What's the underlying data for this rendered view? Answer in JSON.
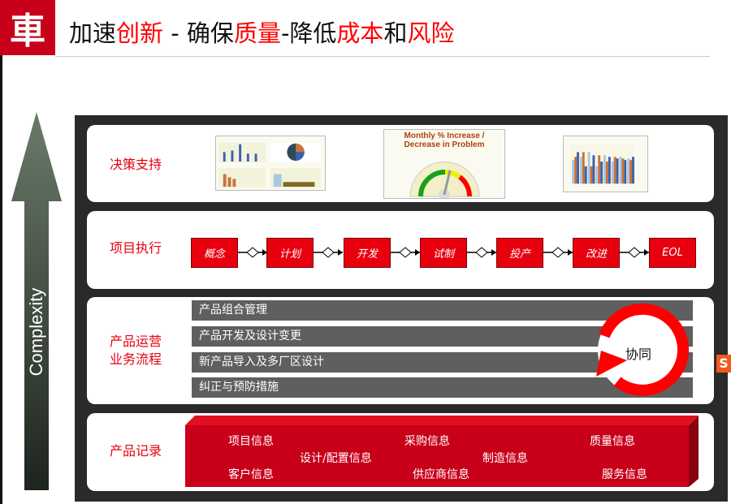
{
  "header": {
    "logo_glyph": "車",
    "title_parts": [
      {
        "text": "加速",
        "red": false
      },
      {
        "text": "创新",
        "red": true
      },
      {
        "text": " - 确保",
        "red": false
      },
      {
        "text": "质量",
        "red": true
      },
      {
        "text": "-降低",
        "red": false
      },
      {
        "text": "成本",
        "red": true
      },
      {
        "text": "和",
        "red": false
      },
      {
        "text": "风险",
        "red": true
      }
    ]
  },
  "axis": {
    "label": "Complexity"
  },
  "rows": {
    "decision": {
      "label": "决策支持",
      "gauge_title": "Monthly % Increase / Decrease in Problem"
    },
    "execution": {
      "label": "项目执行",
      "steps": [
        "概念",
        "计划",
        "开发",
        "试制",
        "投产",
        "改进",
        "EOL"
      ]
    },
    "operations": {
      "label_line1": "产品运营",
      "label_line2": "业务流程",
      "bars": [
        "产品组合管理",
        "产品开发及设计变更",
        "新产品导入及多厂区设计",
        "纠正与预防措施"
      ],
      "cycle_label": "协同"
    },
    "records": {
      "label": "产品记录",
      "items": [
        "项目信息",
        "客户信息",
        "设计/配置信息",
        "采购信息",
        "供应商信息",
        "制造信息",
        "质量信息",
        "服务信息"
      ]
    }
  },
  "colors": {
    "accent": "#e8000f",
    "logo": "#c8001a",
    "bar": "#5f5f5f",
    "frame": "#2a2a2a"
  },
  "tray": {
    "glyph": "S"
  }
}
